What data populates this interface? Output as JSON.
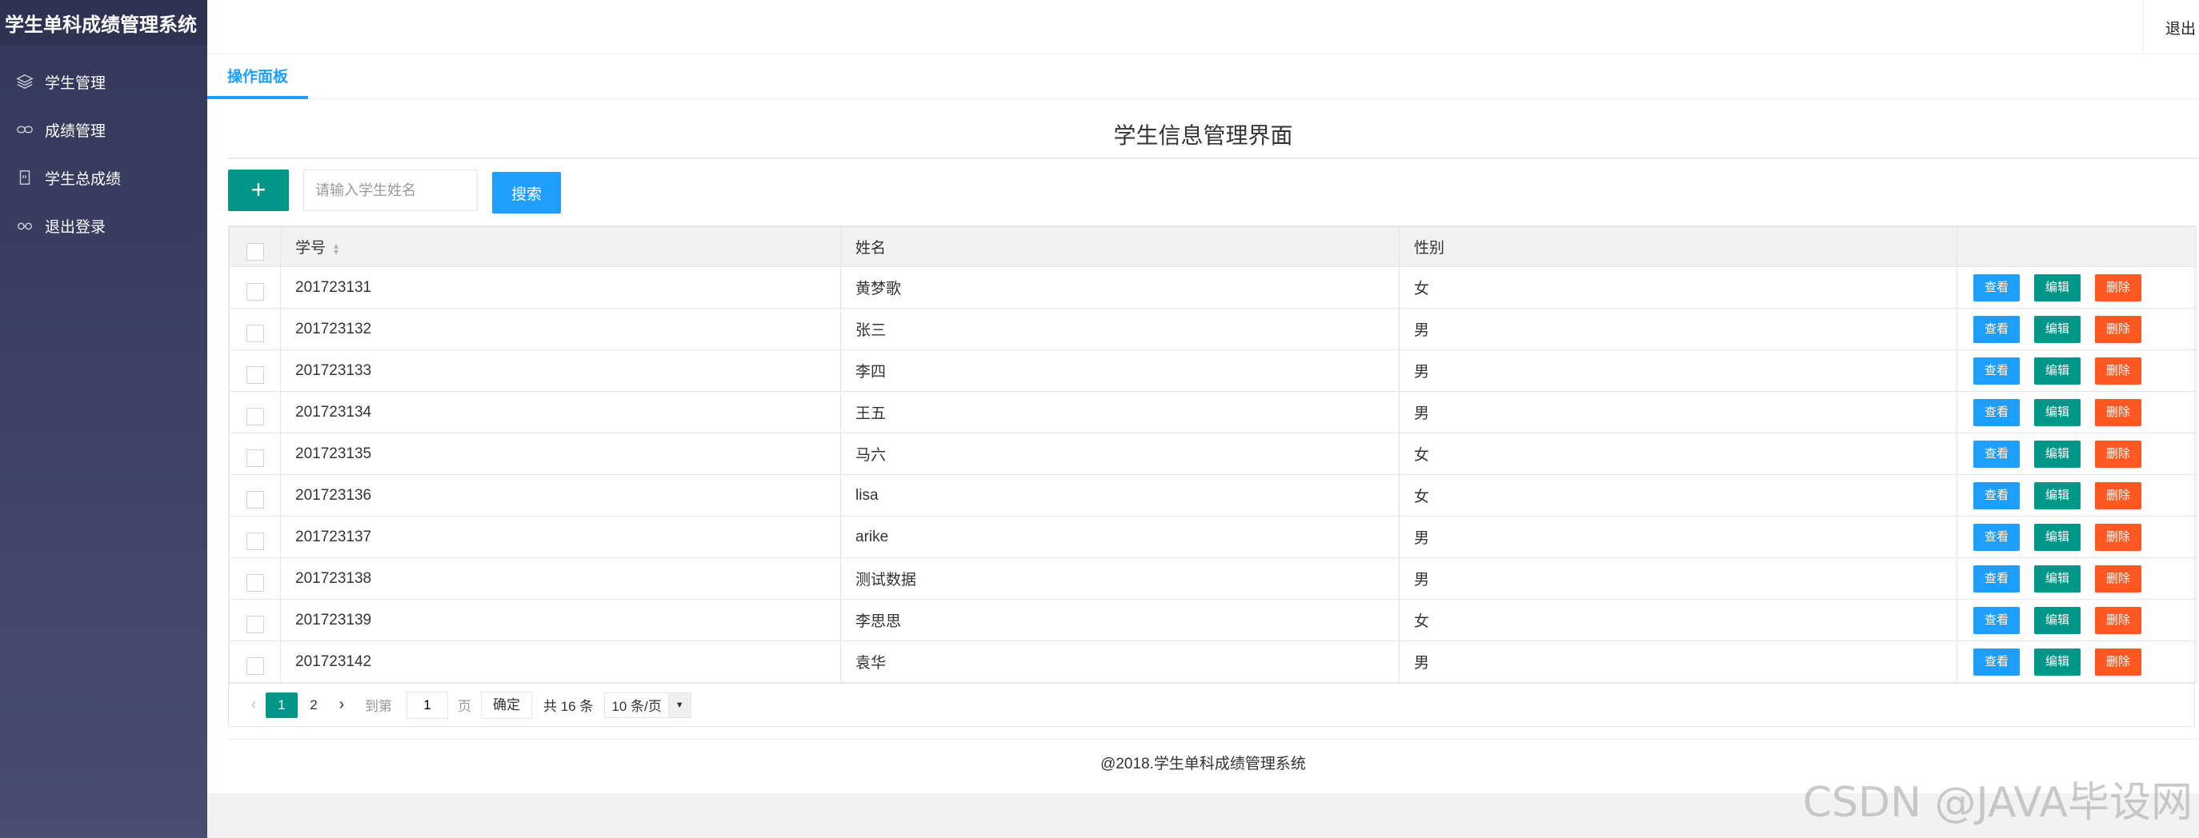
{
  "app": {
    "title": "学生单科成绩管理系统",
    "logout_top": "退出"
  },
  "sidebar": {
    "items": [
      {
        "label": "学生管理",
        "icon": "layers-icon"
      },
      {
        "label": "成绩管理",
        "icon": "link-icon"
      },
      {
        "label": "学生总成绩",
        "icon": "file-icon"
      },
      {
        "label": "退出登录",
        "icon": "infinity-icon"
      }
    ]
  },
  "tabs": [
    {
      "label": "操作面板"
    }
  ],
  "page": {
    "title": "学生信息管理界面",
    "add_label": "+",
    "search_placeholder": "请输入学生姓名",
    "search_label": "搜索"
  },
  "table": {
    "columns": [
      "学号",
      "姓名",
      "性别",
      ""
    ],
    "actions": {
      "view": "查看",
      "edit": "编辑",
      "delete": "删除"
    },
    "rows": [
      {
        "id": "201723131",
        "name": "黄梦歌",
        "gender": "女"
      },
      {
        "id": "201723132",
        "name": "张三",
        "gender": "男"
      },
      {
        "id": "201723133",
        "name": "李四",
        "gender": "男"
      },
      {
        "id": "201723134",
        "name": "王五",
        "gender": "男"
      },
      {
        "id": "201723135",
        "name": "马六",
        "gender": "女"
      },
      {
        "id": "201723136",
        "name": "lisa",
        "gender": "女"
      },
      {
        "id": "201723137",
        "name": "arike",
        "gender": "男"
      },
      {
        "id": "201723138",
        "name": "测试数据",
        "gender": "男"
      },
      {
        "id": "201723139",
        "name": "李思思",
        "gender": "女"
      },
      {
        "id": "201723142",
        "name": "袁华",
        "gender": "男"
      }
    ]
  },
  "pager": {
    "pages": [
      "1",
      "2"
    ],
    "goto_label": "到第",
    "goto_value": "1",
    "page_unit": "页",
    "confirm_label": "确定",
    "total_label": "共 16 条",
    "limit_label": "10 条/页"
  },
  "footer": {
    "text": "@2018.学生单科成绩管理系统"
  },
  "watermark": "CSDN @JAVA毕设网",
  "colors": {
    "sidebar": "#3e4163",
    "primary": "#009688",
    "blue": "#1e9fff",
    "danger": "#ff5722"
  }
}
